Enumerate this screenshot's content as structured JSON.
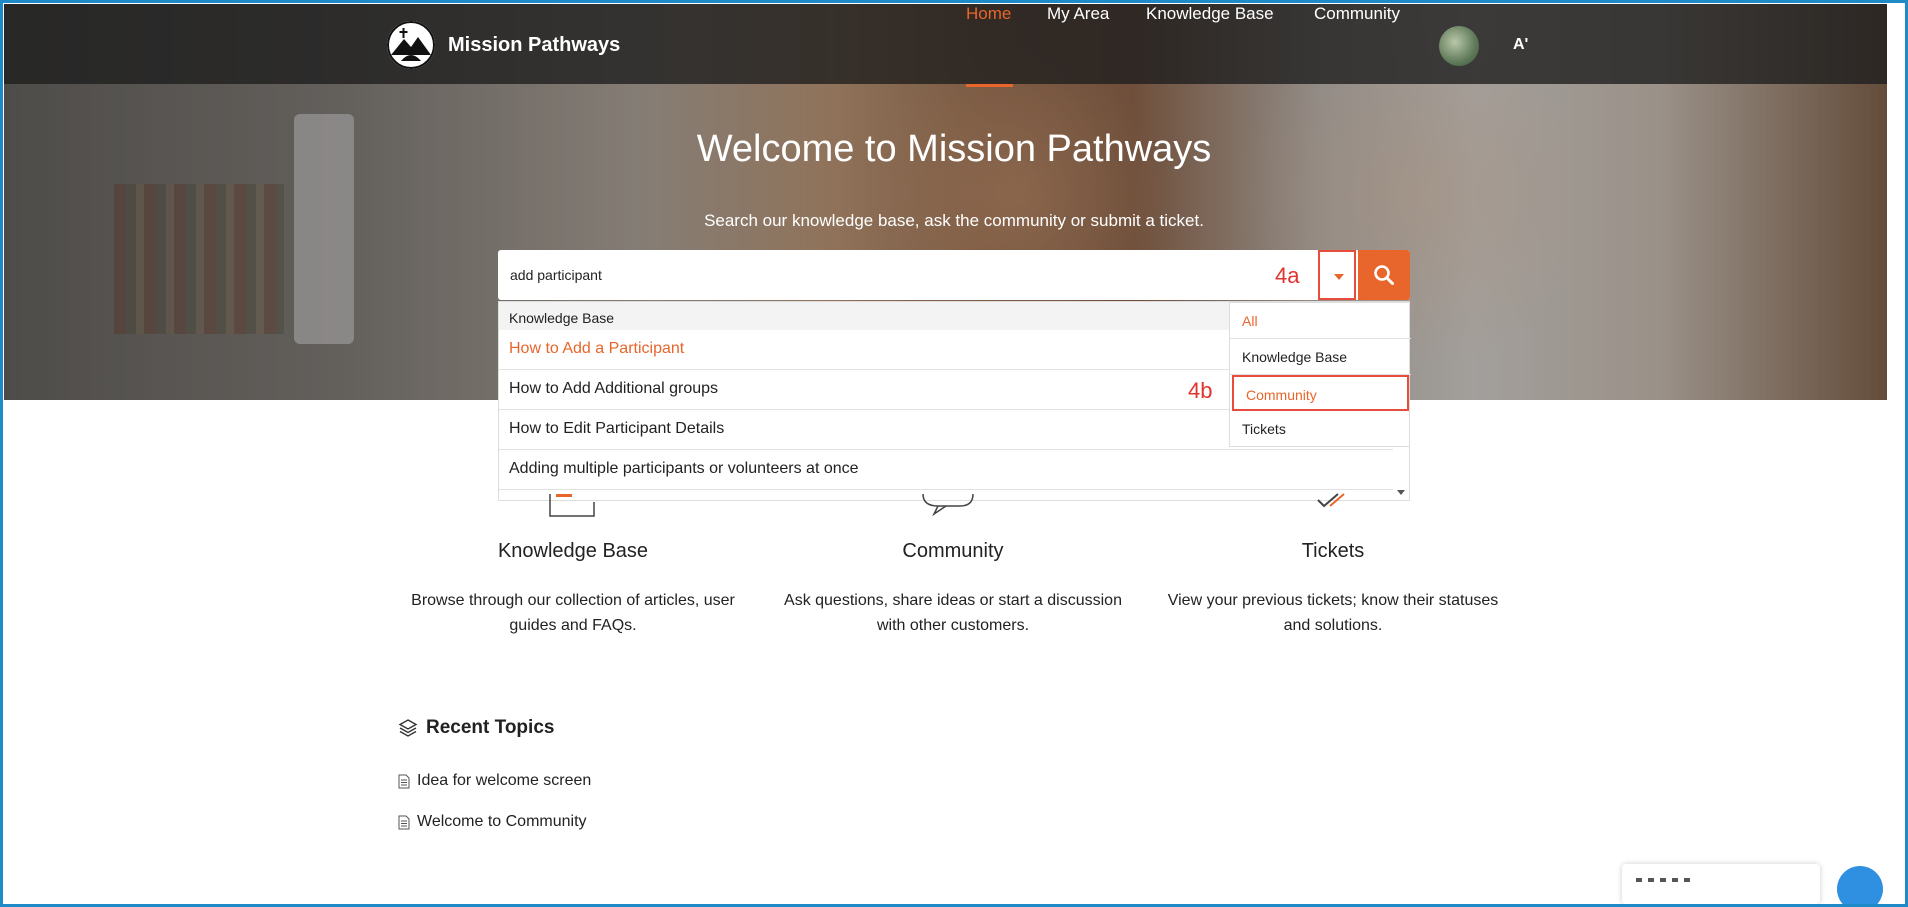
{
  "app": {
    "brand": "Mission Pathways"
  },
  "nav": {
    "items": [
      {
        "label": "Home",
        "active": true
      },
      {
        "label": "My Area",
        "active": false
      },
      {
        "label": "Knowledge Base",
        "active": false
      },
      {
        "label": "Community",
        "active": false
      }
    ],
    "font_toggle": "A'"
  },
  "hero": {
    "title": "Welcome to Mission Pathways",
    "subtitle": "Search our knowledge base, ask the community or submit a ticket."
  },
  "search": {
    "value": "add participant",
    "annotation_dropdown": "4a",
    "annotation_filter": "4b",
    "filter_options": [
      {
        "label": "All",
        "selected": true
      },
      {
        "label": "Knowledge Base",
        "selected": false
      },
      {
        "label": "Community",
        "selected": false,
        "highlighted": true
      },
      {
        "label": "Tickets",
        "selected": false
      }
    ],
    "suggestions_group": "Knowledge Base",
    "suggestions": [
      "How to Add a Participant",
      "How to Add Additional groups",
      "How to Edit Participant Details",
      "Adding multiple participants or volunteers at once"
    ]
  },
  "features": [
    {
      "title": "Knowledge Base",
      "desc": "Browse through our collection of articles, user guides and FAQs."
    },
    {
      "title": "Community",
      "desc": "Ask questions, share ideas or start a discussion with other customers."
    },
    {
      "title": "Tickets",
      "desc": "View your previous tickets; know their statuses and solutions."
    }
  ],
  "recent": {
    "title": "Recent Topics",
    "topics": [
      "Idea for welcome screen",
      "Welcome to Community"
    ]
  },
  "colors": {
    "accent": "#e8652b",
    "annotation": "#e74c3c",
    "frame": "#1e8ac8"
  }
}
